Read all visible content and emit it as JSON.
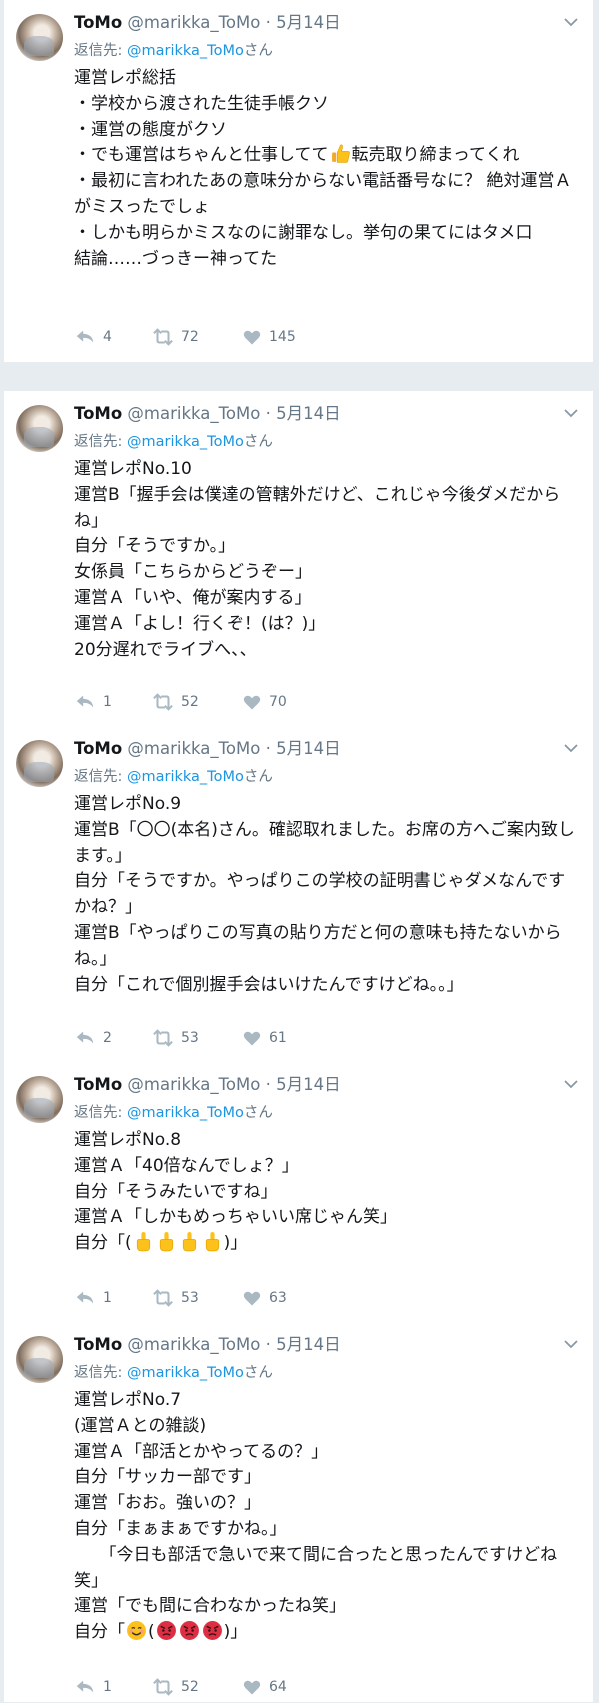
{
  "colors": {
    "background": "#e6ecf0",
    "card": "#ffffff",
    "text": "#14171a",
    "muted": "#657786",
    "mention": "#1b95e0"
  },
  "icons": {
    "reply": "reply-icon",
    "retweet": "retweet-icon",
    "like": "heart-icon",
    "menu": "chevron-down-icon",
    "avatar": "profile-photo"
  },
  "tweets": [
    {
      "name": "ToMo",
      "handle": "@marikka_ToMo",
      "dot": "·",
      "date": "5月14日",
      "reply_prefix": "返信先: ",
      "reply_mention": "@marikka_ToMo",
      "reply_suffix": "さん",
      "lines": [
        "運営レポ総括",
        "・学校から渡された生徒手帳クソ",
        "・運営の態度がクソ",
        "・でも運営はちゃんと仕事してて",
        "転売取り締まってくれ",
        "・最初に言われたあの意味分からない電話番号なに？ 絶対運営Ａがミスったでしょ",
        "・しかも明らかミスなのに謝罪なし。挙句の果てにはタメ口",
        "結論……づっきー神ってた"
      ],
      "emoji": [
        "thumbs-up-emoji"
      ],
      "replies": "4",
      "retweets": "72",
      "likes": "145"
    },
    {
      "name": "ToMo",
      "handle": "@marikka_ToMo",
      "dot": "·",
      "date": "5月14日",
      "reply_prefix": "返信先: ",
      "reply_mention": "@marikka_ToMo",
      "reply_suffix": "さん",
      "lines": [
        "運営レポNo.10",
        "運営B「握手会は僕達の管轄外だけど、これじゃ今後ダメだからね」",
        "自分「そうですか。」",
        "女係員「こちらからどうぞー」",
        "運営Ａ「いや、俺が案内する」",
        "運営Ａ「よし！行くぞ！(は？)」",
        "20分遅れでライブへ、、"
      ],
      "replies": "1",
      "retweets": "52",
      "likes": "70"
    },
    {
      "name": "ToMo",
      "handle": "@marikka_ToMo",
      "dot": "·",
      "date": "5月14日",
      "reply_prefix": "返信先: ",
      "reply_mention": "@marikka_ToMo",
      "reply_suffix": "さん",
      "lines": [
        "運営レポNo.9",
        "運営B「〇〇(本名)さん。確認取れました。お席の方へご案内致します。」",
        "自分「そうですか。やっぱりこの学校の証明書じゃダメなんですかね？」",
        "運営B「やっぱりこの写真の貼り方だと何の意味も持たないからね。」",
        "自分「これで個別握手会はいけたんですけどね。。」"
      ],
      "replies": "2",
      "retweets": "53",
      "likes": "61"
    },
    {
      "name": "ToMo",
      "handle": "@marikka_ToMo",
      "dot": "·",
      "date": "5月14日",
      "reply_prefix": "返信先: ",
      "reply_mention": "@marikka_ToMo",
      "reply_suffix": "さん",
      "lines": [
        "運営レポNo.8",
        "運営Ａ「40倍なんでしょ？」",
        "自分「そうみたいですね」",
        "運営Ａ「しかもめっちゃいい席じゃん笑」",
        "自分「(",
        ")」"
      ],
      "emoji": [
        "middle-finger-emoji",
        "middle-finger-emoji",
        "middle-finger-emoji",
        "middle-finger-emoji"
      ],
      "replies": "1",
      "retweets": "53",
      "likes": "63"
    },
    {
      "name": "ToMo",
      "handle": "@marikka_ToMo",
      "dot": "·",
      "date": "5月14日",
      "reply_prefix": "返信先: ",
      "reply_mention": "@marikka_ToMo",
      "reply_suffix": "さん",
      "lines": [
        "運営レポNo.7",
        "(運営Ａとの雑談)",
        "運営Ａ「部活とかやってるの？」",
        "自分「サッカー部です」",
        "運営「おお。強いの？」",
        "自分「まぁまぁですかね。」",
        "　　「今日も部活で急いで来て間に合ったと思ったんですけどね笑」",
        "運営「でも間に合わなかったね笑」",
        "自分「",
        "(",
        ")」"
      ],
      "emoji": [
        "smiling-face-emoji",
        "angry-face-emoji",
        "angry-face-emoji",
        "angry-face-emoji"
      ],
      "replies": "1",
      "retweets": "52",
      "likes": "64"
    }
  ]
}
